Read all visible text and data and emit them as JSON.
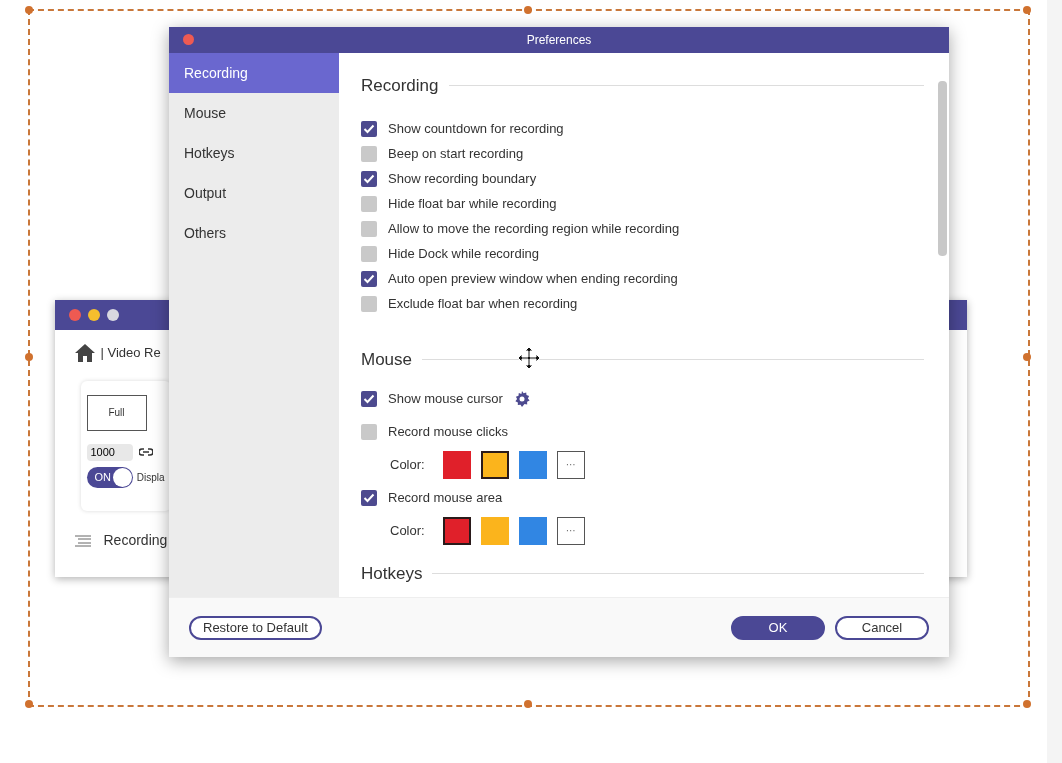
{
  "background_window": {
    "breadcrumb": "| Video Re",
    "mode_label": "Full",
    "size_value": "1000",
    "toggle": {
      "label": "ON",
      "on": true
    },
    "toggle_caption": "Displa",
    "footer_label": "Recording"
  },
  "preferences": {
    "title": "Preferences",
    "sidebar": [
      {
        "label": "Recording",
        "selected": true
      },
      {
        "label": "Mouse",
        "selected": false
      },
      {
        "label": "Hotkeys",
        "selected": false
      },
      {
        "label": "Output",
        "selected": false
      },
      {
        "label": "Others",
        "selected": false
      }
    ],
    "sections": [
      {
        "title": "Recording",
        "items": [
          {
            "kind": "checkbox",
            "label": "Show countdown for recording",
            "checked": true
          },
          {
            "kind": "checkbox",
            "label": "Beep on start recording",
            "checked": false
          },
          {
            "kind": "checkbox",
            "label": "Show recording boundary",
            "checked": true
          },
          {
            "kind": "checkbox",
            "label": "Hide float bar while recording",
            "checked": false
          },
          {
            "kind": "checkbox",
            "label": "Allow to move the recording region while recording",
            "checked": false
          },
          {
            "kind": "checkbox",
            "label": "Hide Dock while recording",
            "checked": false
          },
          {
            "kind": "checkbox",
            "label": "Auto open preview window when ending recording",
            "checked": true
          },
          {
            "kind": "checkbox",
            "label": "Exclude float bar when recording",
            "checked": false
          }
        ]
      },
      {
        "title": "Mouse",
        "items": [
          {
            "kind": "checkbox",
            "label": "Show mouse cursor",
            "checked": true,
            "settings": true
          },
          {
            "kind": "checkbox",
            "label": "Record mouse clicks",
            "checked": false
          },
          {
            "kind": "colors",
            "label": "Color:",
            "more": "···",
            "swatches": [
              {
                "color": "#e0202a",
                "selected": false
              },
              {
                "color": "#fbb41c",
                "selected": true
              },
              {
                "color": "#3186e3",
                "selected": false
              }
            ]
          },
          {
            "kind": "checkbox",
            "label": "Record mouse area",
            "checked": true
          },
          {
            "kind": "colors",
            "label": "Color:",
            "more": "···",
            "swatches": [
              {
                "color": "#e0202a",
                "selected": true
              },
              {
                "color": "#fbb41c",
                "selected": false
              },
              {
                "color": "#3186e3",
                "selected": false
              }
            ]
          }
        ]
      },
      {
        "title": "Hotkeys"
      }
    ],
    "buttons": [
      {
        "label": "Restore to Default",
        "kind": "outline"
      },
      {
        "label": "OK",
        "kind": "primary"
      },
      {
        "label": "Cancel",
        "kind": "outline"
      }
    ]
  }
}
